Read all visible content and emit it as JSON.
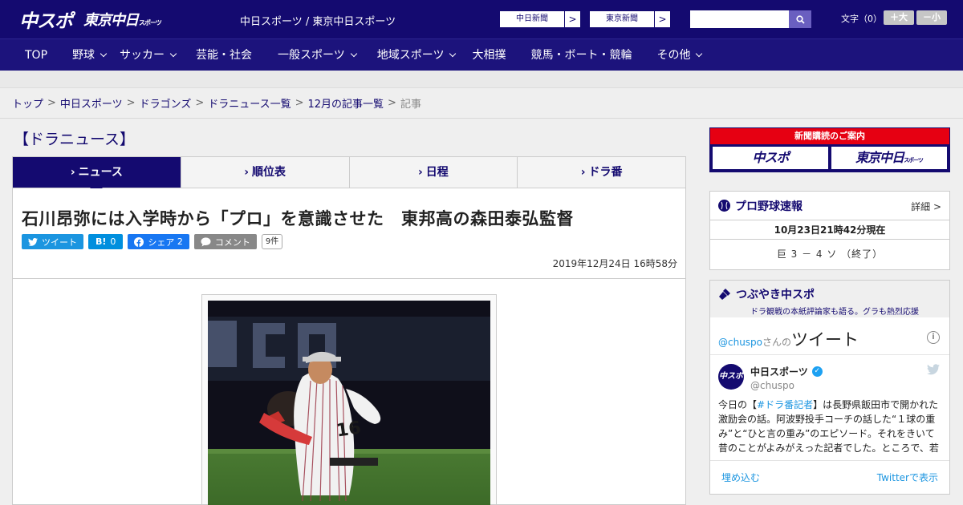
{
  "header": {
    "logo_main": "中スポ",
    "logo_tokyo": "東京中日",
    "logo_tokyo_small": "スポーツ",
    "site_name": "中日スポーツ / 東京中日スポーツ",
    "ext_links": [
      {
        "label": "中日新聞",
        "arrow": ">"
      },
      {
        "label": "東京新聞",
        "arrow": ">"
      }
    ],
    "search_placeholder": "",
    "font_size_label": "文字（0）",
    "font_larger": "＋大",
    "font_smaller": "－小"
  },
  "nav": {
    "items": [
      {
        "label": "TOP",
        "dropdown": false
      },
      {
        "label": "野球",
        "dropdown": true
      },
      {
        "label": "サッカー",
        "dropdown": true
      },
      {
        "label": "芸能・社会",
        "dropdown": false
      },
      {
        "label": "一般スポーツ",
        "dropdown": true
      },
      {
        "label": "地域スポーツ",
        "dropdown": true
      },
      {
        "label": "大相撲",
        "dropdown": false
      },
      {
        "label": "競馬・ボート・競輪",
        "dropdown": false
      },
      {
        "label": "その他",
        "dropdown": true
      }
    ]
  },
  "breadcrumb": {
    "items": [
      "トップ",
      "中日スポーツ",
      "ドラゴンズ",
      "ドラニュース一覧",
      "12月の記事一覧"
    ],
    "separator": ">",
    "current": "記事"
  },
  "section": {
    "title": "【ドラニュース】",
    "tabs": [
      {
        "label": "ニュース",
        "active": true
      },
      {
        "label": "順位表",
        "active": false
      },
      {
        "label": "日程",
        "active": false
      },
      {
        "label": "ドラ番",
        "active": false
      }
    ],
    "tab_arrow": "›"
  },
  "article": {
    "headline": "石川昂弥には入学時から「プロ」を意識させた　東邦高の森田泰弘監督",
    "share": {
      "tweet": "ツイート",
      "hatena_icon": "B!",
      "hatena_count": "0",
      "facebook": "シェア",
      "facebook_count": "2",
      "comment": "コメント",
      "comment_count": "9件"
    },
    "date": "2019年12月24日 16時58分"
  },
  "sidebar": {
    "promo_head": "新聞購読のご案内",
    "promo_logo_1": "中スポ",
    "promo_logo_2": "東京中日",
    "promo_logo_2_small": "スポーツ",
    "score": {
      "title": "プロ野球速報",
      "more": "詳細 >",
      "time": "10月23日21時42分現在",
      "line": "巨 3 － 4 ソ （終了）"
    },
    "tweets": {
      "title": "つぶやき中スポ",
      "subtitle": "ドラ観戦の本紙評論家も語る。グラも熱烈応援",
      "by_handle": "@chuspo",
      "by_san": "さんの",
      "by_tweet": "ツイート",
      "info": "i",
      "avatar": "中スポ",
      "name": "中日スポーツ",
      "handle": "@chuspo",
      "text_1": "今日の【",
      "text_tag": "#ドラ番記者",
      "text_2": "】は長野県飯田市で開かれた激励会の話。阿波野投手コーチの話した“１球の重み”と“ひと言の重み”のエピソード。それをきいて昔のことがよみがえった記者でした。ところで、若い",
      "embed": "埋め込む",
      "view": "Twitterで表示"
    }
  },
  "colors": {
    "navy": "#140a70",
    "nav": "#1c137c",
    "twitter": "#1b95e0",
    "hatena": "#008fde",
    "facebook": "#1877f2",
    "comment": "#888888",
    "promo_red": "#e60012"
  }
}
